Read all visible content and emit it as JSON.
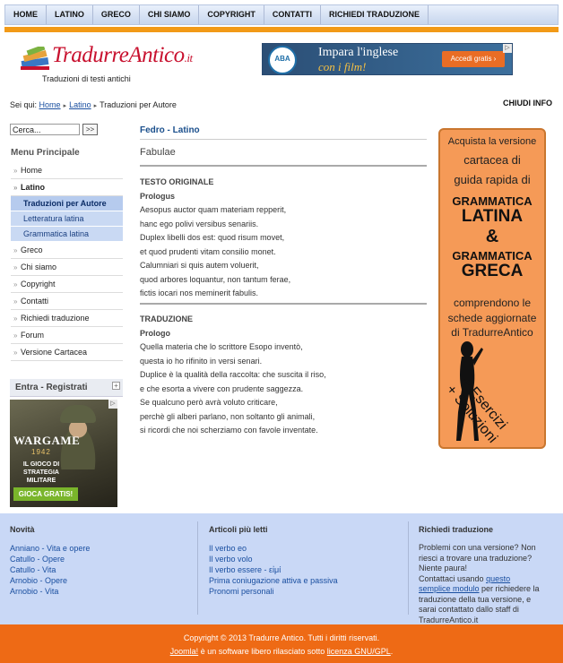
{
  "nav": [
    "HOME",
    "LATINO",
    "GRECO",
    "CHI SIAMO",
    "COPYRIGHT",
    "CONTATTI",
    "RICHIEDI TRADUZIONE"
  ],
  "logo": {
    "name": "TradurreAntico",
    "domain": ".it",
    "tagline": "Traduzioni di testi antichi"
  },
  "ad_top": {
    "logo_text": "ABA",
    "line1": "Impara l'inglese",
    "line2": "con i film!",
    "cta": "Accedi gratis ›",
    "adchoice": "▷"
  },
  "breadcrumb": {
    "prefix": "Sei qui:",
    "items": [
      "Home",
      "Latino",
      "Traduzioni per Autore"
    ]
  },
  "close_info": "CHIUDI INFO",
  "search": {
    "value": "Cerca...",
    "button": ">>"
  },
  "menu": {
    "title": "Menu Principale",
    "items": [
      {
        "label": "Home"
      },
      {
        "label": "Latino"
      },
      {
        "label": "Traduzioni per Autore"
      },
      {
        "label": "Letteratura latina"
      },
      {
        "label": "Grammatica latina"
      },
      {
        "label": "Greco"
      },
      {
        "label": "Chi siamo"
      },
      {
        "label": "Copyright"
      },
      {
        "label": "Contatti"
      },
      {
        "label": "Richiedi traduzione"
      },
      {
        "label": "Forum"
      },
      {
        "label": "Versione Cartacea"
      }
    ]
  },
  "login": {
    "title": "Entra - Registrati",
    "toggle": "+"
  },
  "ad_left": {
    "title": "WARGAME",
    "year": "1942",
    "text": "IL GIOCO DI STRATEGIA MILITARE",
    "cta": "GIOCA GRATIS!",
    "adchoice": "▷"
  },
  "article": {
    "category": "Fedro - Latino",
    "title": "Fabulae",
    "original_heading": "TESTO ORIGINALE",
    "original_sub": "Prologus",
    "original_lines": [
      "Aesopus auctor quam materiam repperit,",
      "hanc ego polivi versibus senariis.",
      "Duplex libelli dos est: quod risum movet,",
      "et quod prudenti vitam consilio monet.",
      "Calumniari si quis autem voluerit,",
      "quod arbores loquantur, non tantum ferae,",
      "fictis iocari nos meminerit fabulis."
    ],
    "translation_heading": "TRADUZIONE",
    "translation_sub": "Prologo",
    "translation_lines": [
      "Quella materia che lo scrittore Esopo inventò,",
      "questa io ho rifinito in versi senari.",
      "Duplice è la qualità della raccolta: che suscita il riso,",
      "e che esorta a vivere con prudente saggezza.",
      "Se qualcuno però avrà voluto criticare,",
      "perchè gli alberi parlano, non soltanto gli animali,",
      "si ricordi che noi scherziamo con favole inventate."
    ]
  },
  "banner": {
    "l1": "Acquista la versione",
    "l2": "cartacea di",
    "l3": "guida rapida di",
    "g1": "GRAMMATICA",
    "g2": "LATINA",
    "amp": "&",
    "g3": "GRAMMATICA",
    "g4": "GRECA",
    "l4": "comprendono le",
    "l5": "schede aggiornate",
    "l6": "di TradurreAntico",
    "e1": "+ Esercizi",
    "e2": "+ Soluzioni"
  },
  "footer": {
    "col1": {
      "title": "Novità",
      "links": [
        "Anniano - Vita e opere",
        "Catullo - Opere",
        "Catullo - Vita",
        "Arnobio - Opere",
        "Arnobio - Vita"
      ]
    },
    "col2": {
      "title": "Articoli più letti",
      "links": [
        "Il verbo eo",
        "Il verbo volo",
        "Il verbo essere - εἰμί",
        "Prima coniugazione attiva e passiva",
        "Pronomi personali"
      ]
    },
    "col3": {
      "title": "Richiedi traduzione",
      "p1": "Problemi con una versione? Non riesci a trovare una traduzione? Niente paura!",
      "p2a": "Contattaci usando ",
      "link": "questo semplice modulo",
      "p2b": " per richiedere la traduzione della tua versione, e sarai contattato dallo staff di TradurreAntico.it"
    }
  },
  "copyright": {
    "line1": "Copyright © 2013 Tradurre Antico. Tutti i diritti riservati.",
    "joomla": "Joomla!",
    "mid": " è un software libero rilasciato sotto ",
    "license": "licenza GNU/GPL",
    "end": "."
  }
}
